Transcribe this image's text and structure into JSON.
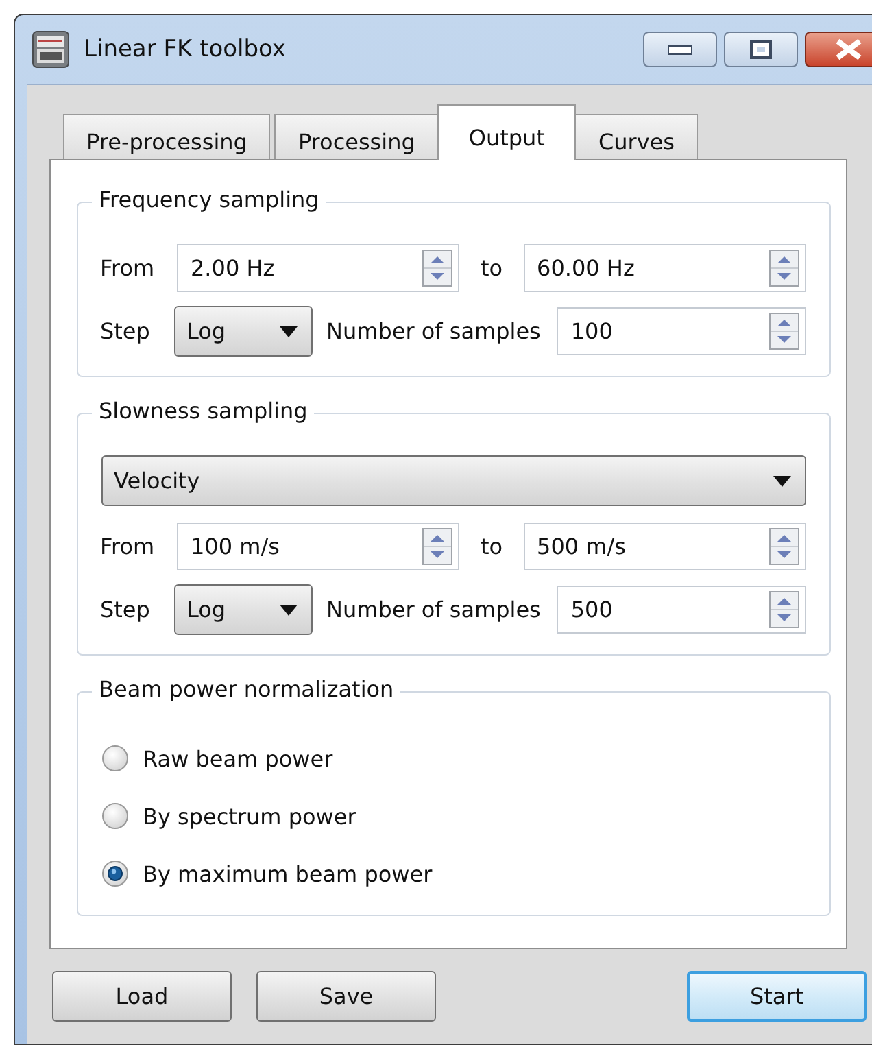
{
  "window": {
    "title": "Linear FK toolbox"
  },
  "tabs": [
    {
      "label": "Pre-processing",
      "selected": false
    },
    {
      "label": "Processing",
      "selected": false
    },
    {
      "label": "Output",
      "selected": true
    },
    {
      "label": "Curves",
      "selected": false
    }
  ],
  "frequency_sampling": {
    "title": "Frequency sampling",
    "from_label": "From",
    "from_value": "2.00 Hz",
    "to_label": "to",
    "to_value": "60.00 Hz",
    "step_label": "Step",
    "step_value": "Log",
    "samples_label": "Number of samples",
    "samples_value": "100"
  },
  "slowness_sampling": {
    "title": "Slowness sampling",
    "mode": "Velocity",
    "from_label": "From",
    "from_value": "100 m/s",
    "to_label": "to",
    "to_value": "500 m/s",
    "step_label": "Step",
    "step_value": "Log",
    "samples_label": "Number of samples",
    "samples_value": "500"
  },
  "beam_power_normalization": {
    "title": "Beam power normalization",
    "options": [
      {
        "label": "Raw beam power",
        "selected": false
      },
      {
        "label": "By spectrum power",
        "selected": false
      },
      {
        "label": "By maximum beam power",
        "selected": true
      }
    ]
  },
  "buttons": [
    {
      "label": "Load",
      "default": false
    },
    {
      "label": "Save",
      "default": false
    },
    {
      "label": "Start",
      "default": true
    }
  ]
}
